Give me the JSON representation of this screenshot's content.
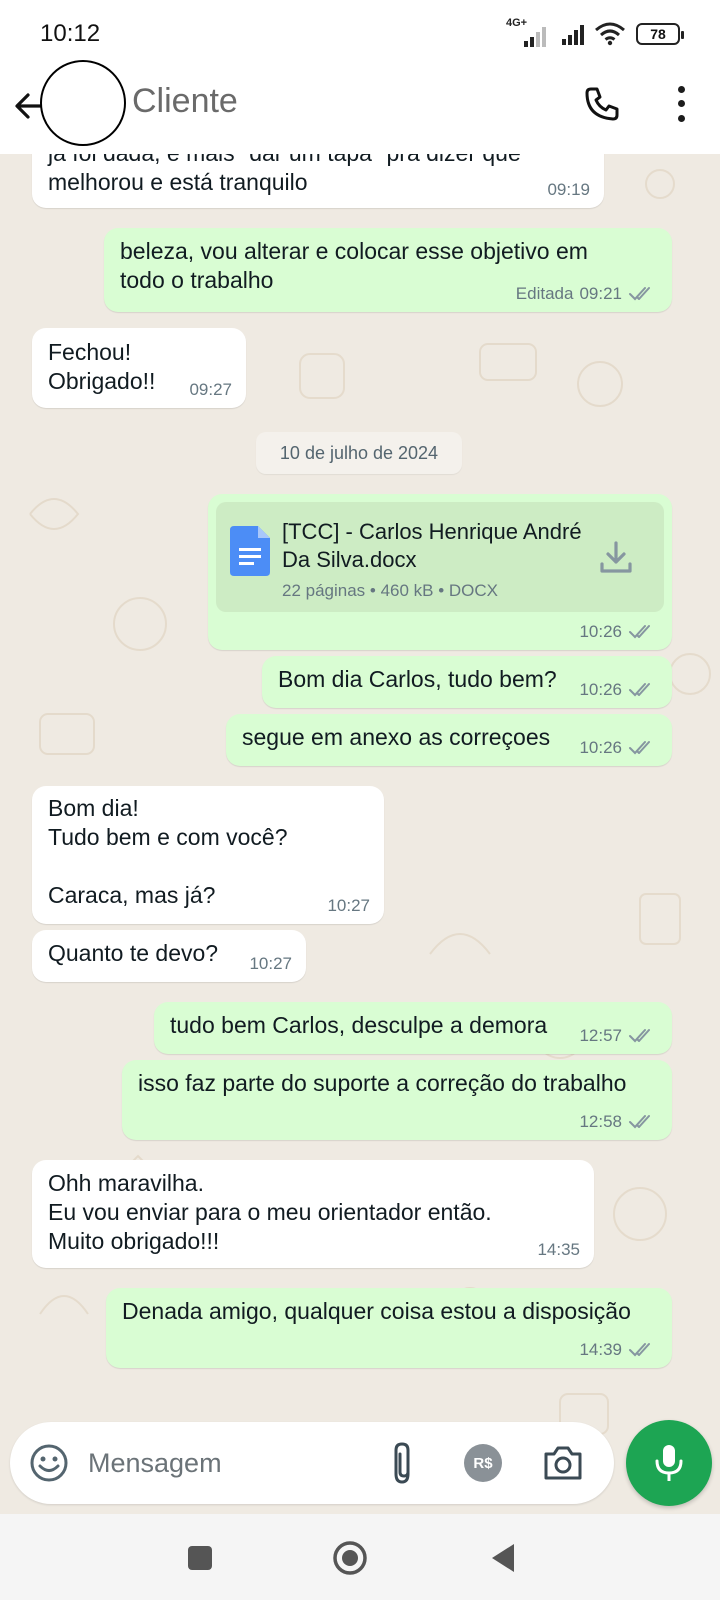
{
  "status_bar": {
    "time": "10:12",
    "network": "4G+",
    "battery": "78"
  },
  "header": {
    "contact_name": "Cliente"
  },
  "messages": [
    {
      "dir": "in",
      "text": "já foi dada, e mais \"dar um tapa\" pra dizer que\nmelhorou e está tranquilo",
      "time": "09:19"
    },
    {
      "dir": "out",
      "text": "beleza, vou alterar e colocar esse objetivo em\ntodo o trabalho",
      "edited": "Editada",
      "time": "09:21"
    },
    {
      "dir": "in",
      "text": "Fechou!\nObrigado!!",
      "time": "09:27"
    },
    {
      "dir": "out",
      "type": "document",
      "doc_name": "[TCC] - Carlos Henrique André Da Silva.docx",
      "doc_info": "22 páginas • 460 kB • DOCX",
      "time": "10:26"
    },
    {
      "dir": "out",
      "text": "Bom dia Carlos, tudo bem?",
      "time": "10:26"
    },
    {
      "dir": "out",
      "text": "segue em anexo as correçoes",
      "time": "10:26"
    },
    {
      "dir": "in",
      "text": "Bom dia!\nTudo bem e com você?\n\nCaraca, mas já?",
      "time": "10:27"
    },
    {
      "dir": "in",
      "text": "Quanto te devo?",
      "time": "10:27"
    },
    {
      "dir": "out",
      "text": "tudo bem Carlos, desculpe a demora",
      "time": "12:57"
    },
    {
      "dir": "out",
      "text": "isso faz parte do suporte a correção do trabalho",
      "time": "12:58"
    },
    {
      "dir": "in",
      "text": "Ohh maravilha.\nEu vou enviar para o meu orientador então.\nMuito obrigado!!!",
      "time": "14:35"
    },
    {
      "dir": "out",
      "text": "Denada amigo, qualquer coisa estou a disposição",
      "time": "14:39"
    }
  ],
  "date_chip": "10 de julho de 2024",
  "composer": {
    "placeholder": "Mensagem",
    "pay_label": "R$"
  },
  "icons": {
    "back": "arrow-left-icon",
    "call": "phone-icon",
    "menu": "more-vertical-icon",
    "emoji": "emoji-icon",
    "attach": "paperclip-icon",
    "camera": "camera-icon",
    "mic": "microphone-icon",
    "read": "double-check-icon",
    "download": "download-icon",
    "document": "document-icon"
  },
  "colors": {
    "incoming": "#ffffff",
    "outgoing": "#d9fdd3",
    "accent": "#1da553",
    "background": "#efeae2"
  }
}
